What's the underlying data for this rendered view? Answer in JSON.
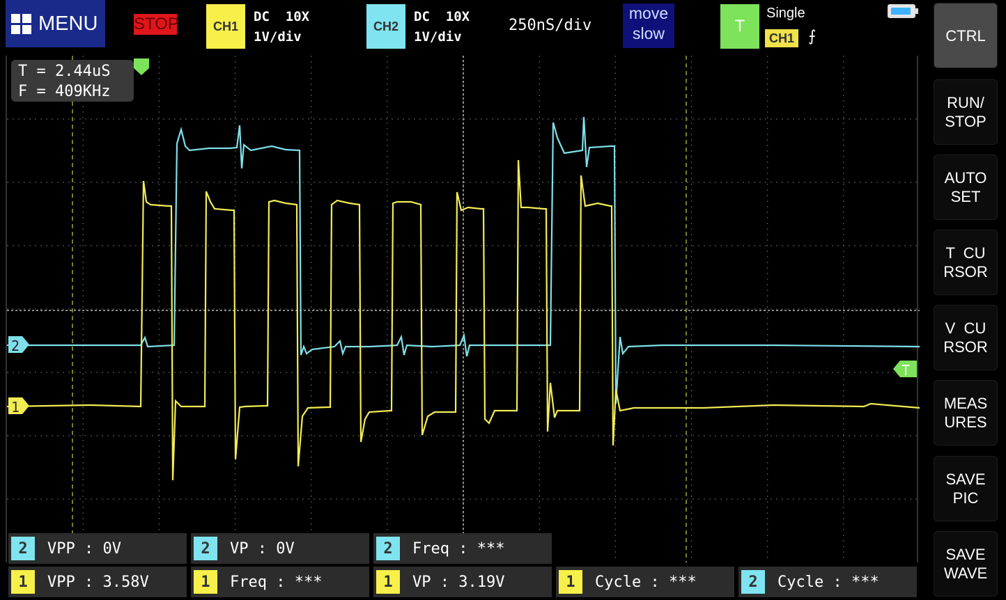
{
  "topbar": {
    "menu_label": "MENU",
    "state_label": "STOP",
    "ch1": {
      "badge": "CH1",
      "coupling": "DC  10X",
      "scale": "1V/div",
      "color": "#f7f04a"
    },
    "ch2": {
      "badge": "CH2",
      "coupling": "DC  10X",
      "scale": "1V/div",
      "color": "#7fe4ef"
    },
    "timebase": "250nS/div",
    "move_mode": {
      "line1": "move",
      "line2": "slow"
    },
    "trigger": {
      "badge": "T",
      "mode": "Single",
      "source": "CH1",
      "edge_glyph": "⨍"
    },
    "battery_icon": "battery-charging-icon"
  },
  "cursor_readout": {
    "period": "T = 2.44uS",
    "frequency": "F = 409KHz"
  },
  "markers": {
    "ch2_marker": "2",
    "ch1_marker": "1",
    "trigger_marker": "T"
  },
  "side_buttons": [
    {
      "id": "ctrl",
      "label": "CTRL",
      "active": true
    },
    {
      "id": "run-stop",
      "label": "RUN/\nSTOP",
      "active": false
    },
    {
      "id": "auto-set",
      "label": "AUTO\nSET",
      "active": false
    },
    {
      "id": "t-cursor",
      "label": "T  CU\nRSOR",
      "active": false
    },
    {
      "id": "v-cursor",
      "label": "V  CU\nRSOR",
      "active": false
    },
    {
      "id": "measures",
      "label": "MEAS\nURES",
      "active": false
    },
    {
      "id": "save-pic",
      "label": "SAVE\nPIC",
      "active": false
    },
    {
      "id": "save-wave",
      "label": "SAVE\nWAVE",
      "active": false
    }
  ],
  "measurements": {
    "row1": [
      {
        "ch": "2",
        "text": "VPP  : 0V"
      },
      {
        "ch": "2",
        "text": "VP  : 0V"
      },
      {
        "ch": "2",
        "text": "Freq : ***"
      }
    ],
    "row2": [
      {
        "ch": "1",
        "text": "VPP  : 3.58V"
      },
      {
        "ch": "1",
        "text": "Freq : ***"
      },
      {
        "ch": "1",
        "text": "VP  : 3.19V"
      },
      {
        "ch": "1",
        "text": "Cycle : ***"
      },
      {
        "ch": "2",
        "text": "Cycle : ***"
      }
    ]
  },
  "colors": {
    "ch1": "#f3ec54",
    "ch2": "#7fe0ea",
    "grid": "#7a7a7a",
    "cursor_line": "#8fae3f"
  }
}
